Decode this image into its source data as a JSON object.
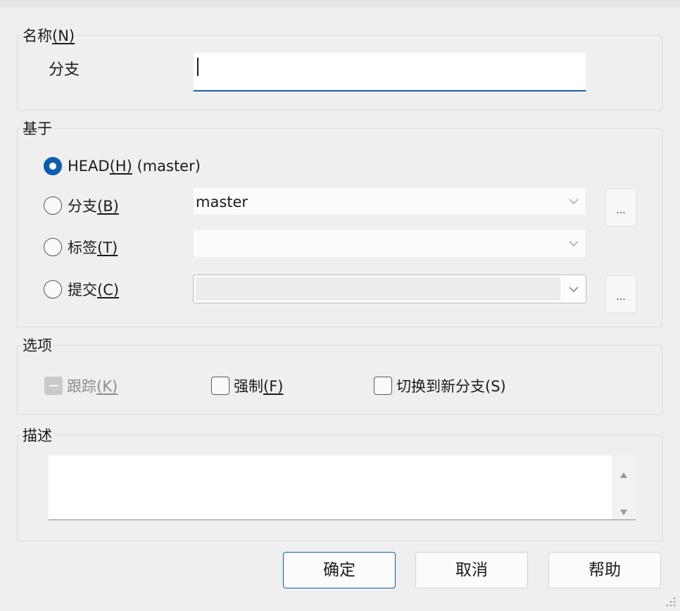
{
  "name_group": {
    "legend": "名称",
    "legend_mnemonic": "(N)",
    "branch_label": "分支",
    "branch_value": ""
  },
  "base_group": {
    "legend": "基于",
    "head_label": "HEAD",
    "head_mnemonic": "(H)",
    "head_extra": "(master)",
    "branch_label": "分支",
    "branch_mnemonic": "(B)",
    "branch_value": "master",
    "tag_label": "标签",
    "tag_mnemonic": "(T)",
    "tag_value": "",
    "commit_label": "提交",
    "commit_mnemonic": "(C)",
    "commit_value": "",
    "browse_label": "...",
    "selected": "head"
  },
  "options_group": {
    "legend": "选项",
    "track_label": "跟踪",
    "track_mnemonic": "(K)",
    "force_label": "强制",
    "force_mnemonic": "(F)",
    "switch_label": "切换到新分支(S)"
  },
  "desc_group": {
    "legend": "描述",
    "value": ""
  },
  "buttons": {
    "ok": "确定",
    "cancel": "取消",
    "help": "帮助"
  },
  "colors": {
    "accent": "#0a5fb0",
    "background": "#efefef"
  }
}
